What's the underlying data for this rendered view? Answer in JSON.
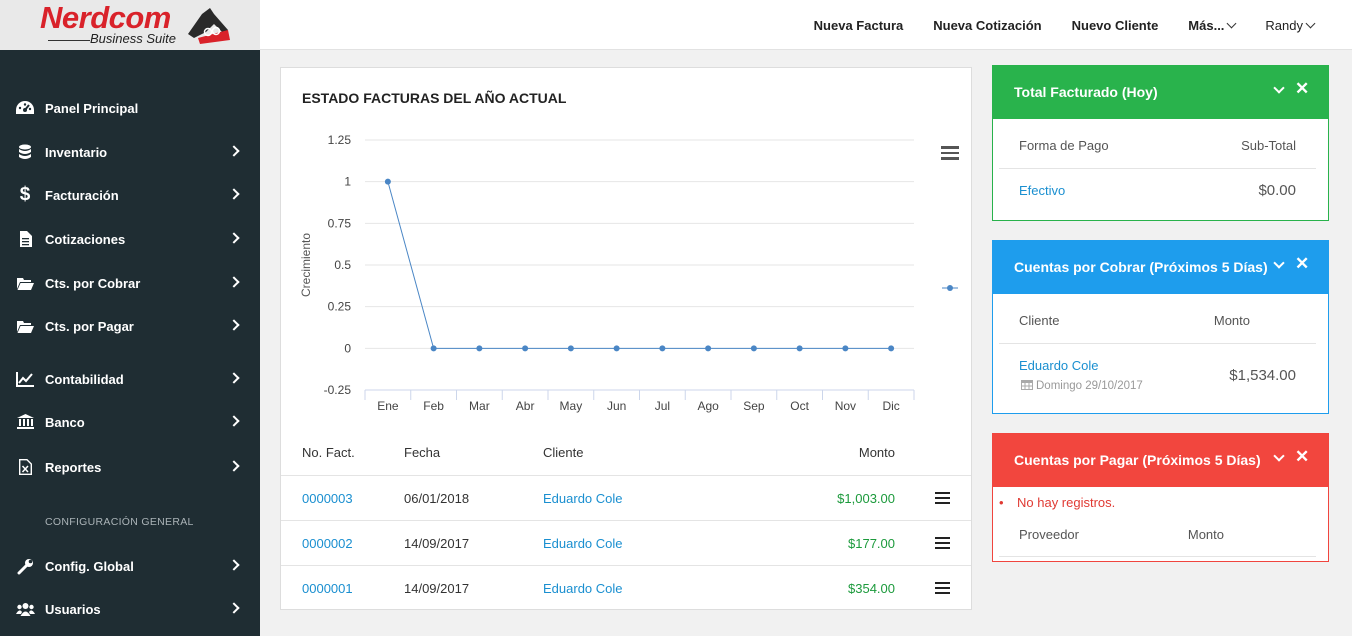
{
  "brand": {
    "name": "Nerdcom",
    "subtitle": "Business Suite"
  },
  "topnav": {
    "items": [
      {
        "label": "Nueva Factura"
      },
      {
        "label": "Nueva Cotización"
      },
      {
        "label": "Nuevo Cliente"
      },
      {
        "label": "Más..."
      }
    ],
    "user": "Randy"
  },
  "sidebar": {
    "items": [
      {
        "label": "Panel Principal",
        "icon": "dashboard-icon"
      },
      {
        "label": "Inventario",
        "icon": "database-icon"
      },
      {
        "label": "Facturación",
        "icon": "dollar-icon"
      },
      {
        "label": "Cotizaciones",
        "icon": "document-icon"
      },
      {
        "label": "Cts. por Cobrar",
        "icon": "folder-open-icon"
      },
      {
        "label": "Cts. por Pagar",
        "icon": "folder-open-icon"
      },
      {
        "label": "Contabilidad",
        "icon": "line-chart-icon"
      },
      {
        "label": "Banco",
        "icon": "bank-icon"
      },
      {
        "label": "Reportes",
        "icon": "excel-file-icon"
      }
    ],
    "section_label": "CONFIGURACIÓN GENERAL",
    "config_items": [
      {
        "label": "Config. Global",
        "icon": "wrench-icon"
      },
      {
        "label": "Usuarios",
        "icon": "users-icon"
      }
    ]
  },
  "main": {
    "chart_title": "ESTADO FACTURAS DEL AÑO ACTUAL",
    "table": {
      "headers": {
        "num": "No. Fact.",
        "date": "Fecha",
        "client": "Cliente",
        "amount": "Monto"
      },
      "rows": [
        {
          "num": "0000003",
          "date": "06/01/2018",
          "client": "Eduardo Cole",
          "amount": "$1,003.00"
        },
        {
          "num": "0000002",
          "date": "14/09/2017",
          "client": "Eduardo Cole",
          "amount": "$177.00"
        },
        {
          "num": "0000001",
          "date": "14/09/2017",
          "client": "Eduardo Cole",
          "amount": "$354.00"
        }
      ]
    }
  },
  "chart_data": {
    "type": "line",
    "title": "",
    "xlabel": "",
    "ylabel": "Crecimiento",
    "categories": [
      "Ene",
      "Feb",
      "Mar",
      "Abr",
      "May",
      "Jun",
      "Jul",
      "Ago",
      "Sep",
      "Oct",
      "Nov",
      "Dic"
    ],
    "series": [
      {
        "values": [
          1,
          0,
          0,
          0,
          0,
          0,
          0,
          0,
          0,
          0,
          0,
          0
        ]
      }
    ],
    "ylim": [
      -0.25,
      1.25
    ],
    "yticks": [
      "1.25",
      "1",
      "0.75",
      "0.5",
      "0.25",
      "0",
      "-0.25"
    ],
    "grid": true,
    "color": "#4a86c5"
  },
  "panels": {
    "facturado": {
      "title": "Total Facturado (Hoy)",
      "col_left": "Forma de Pago",
      "col_right": "Sub-Total",
      "row_left": "Efectivo",
      "row_right": "$0.00",
      "color": "#29b34c"
    },
    "cobrar": {
      "title": "Cuentas por Cobrar (Próximos 5 Días)",
      "col_left": "Cliente",
      "col_right": "Monto",
      "row_left": "Eduardo Cole",
      "row_date": "Domingo 29/10/2017",
      "row_right": "$1,534.00",
      "color": "#1e9ded"
    },
    "pagar": {
      "title": "Cuentas por Pagar (Próximos 5 Días)",
      "notice": "No hay registros.",
      "col_left": "Proveedor",
      "col_right": "Monto",
      "color": "#f2463e"
    }
  }
}
